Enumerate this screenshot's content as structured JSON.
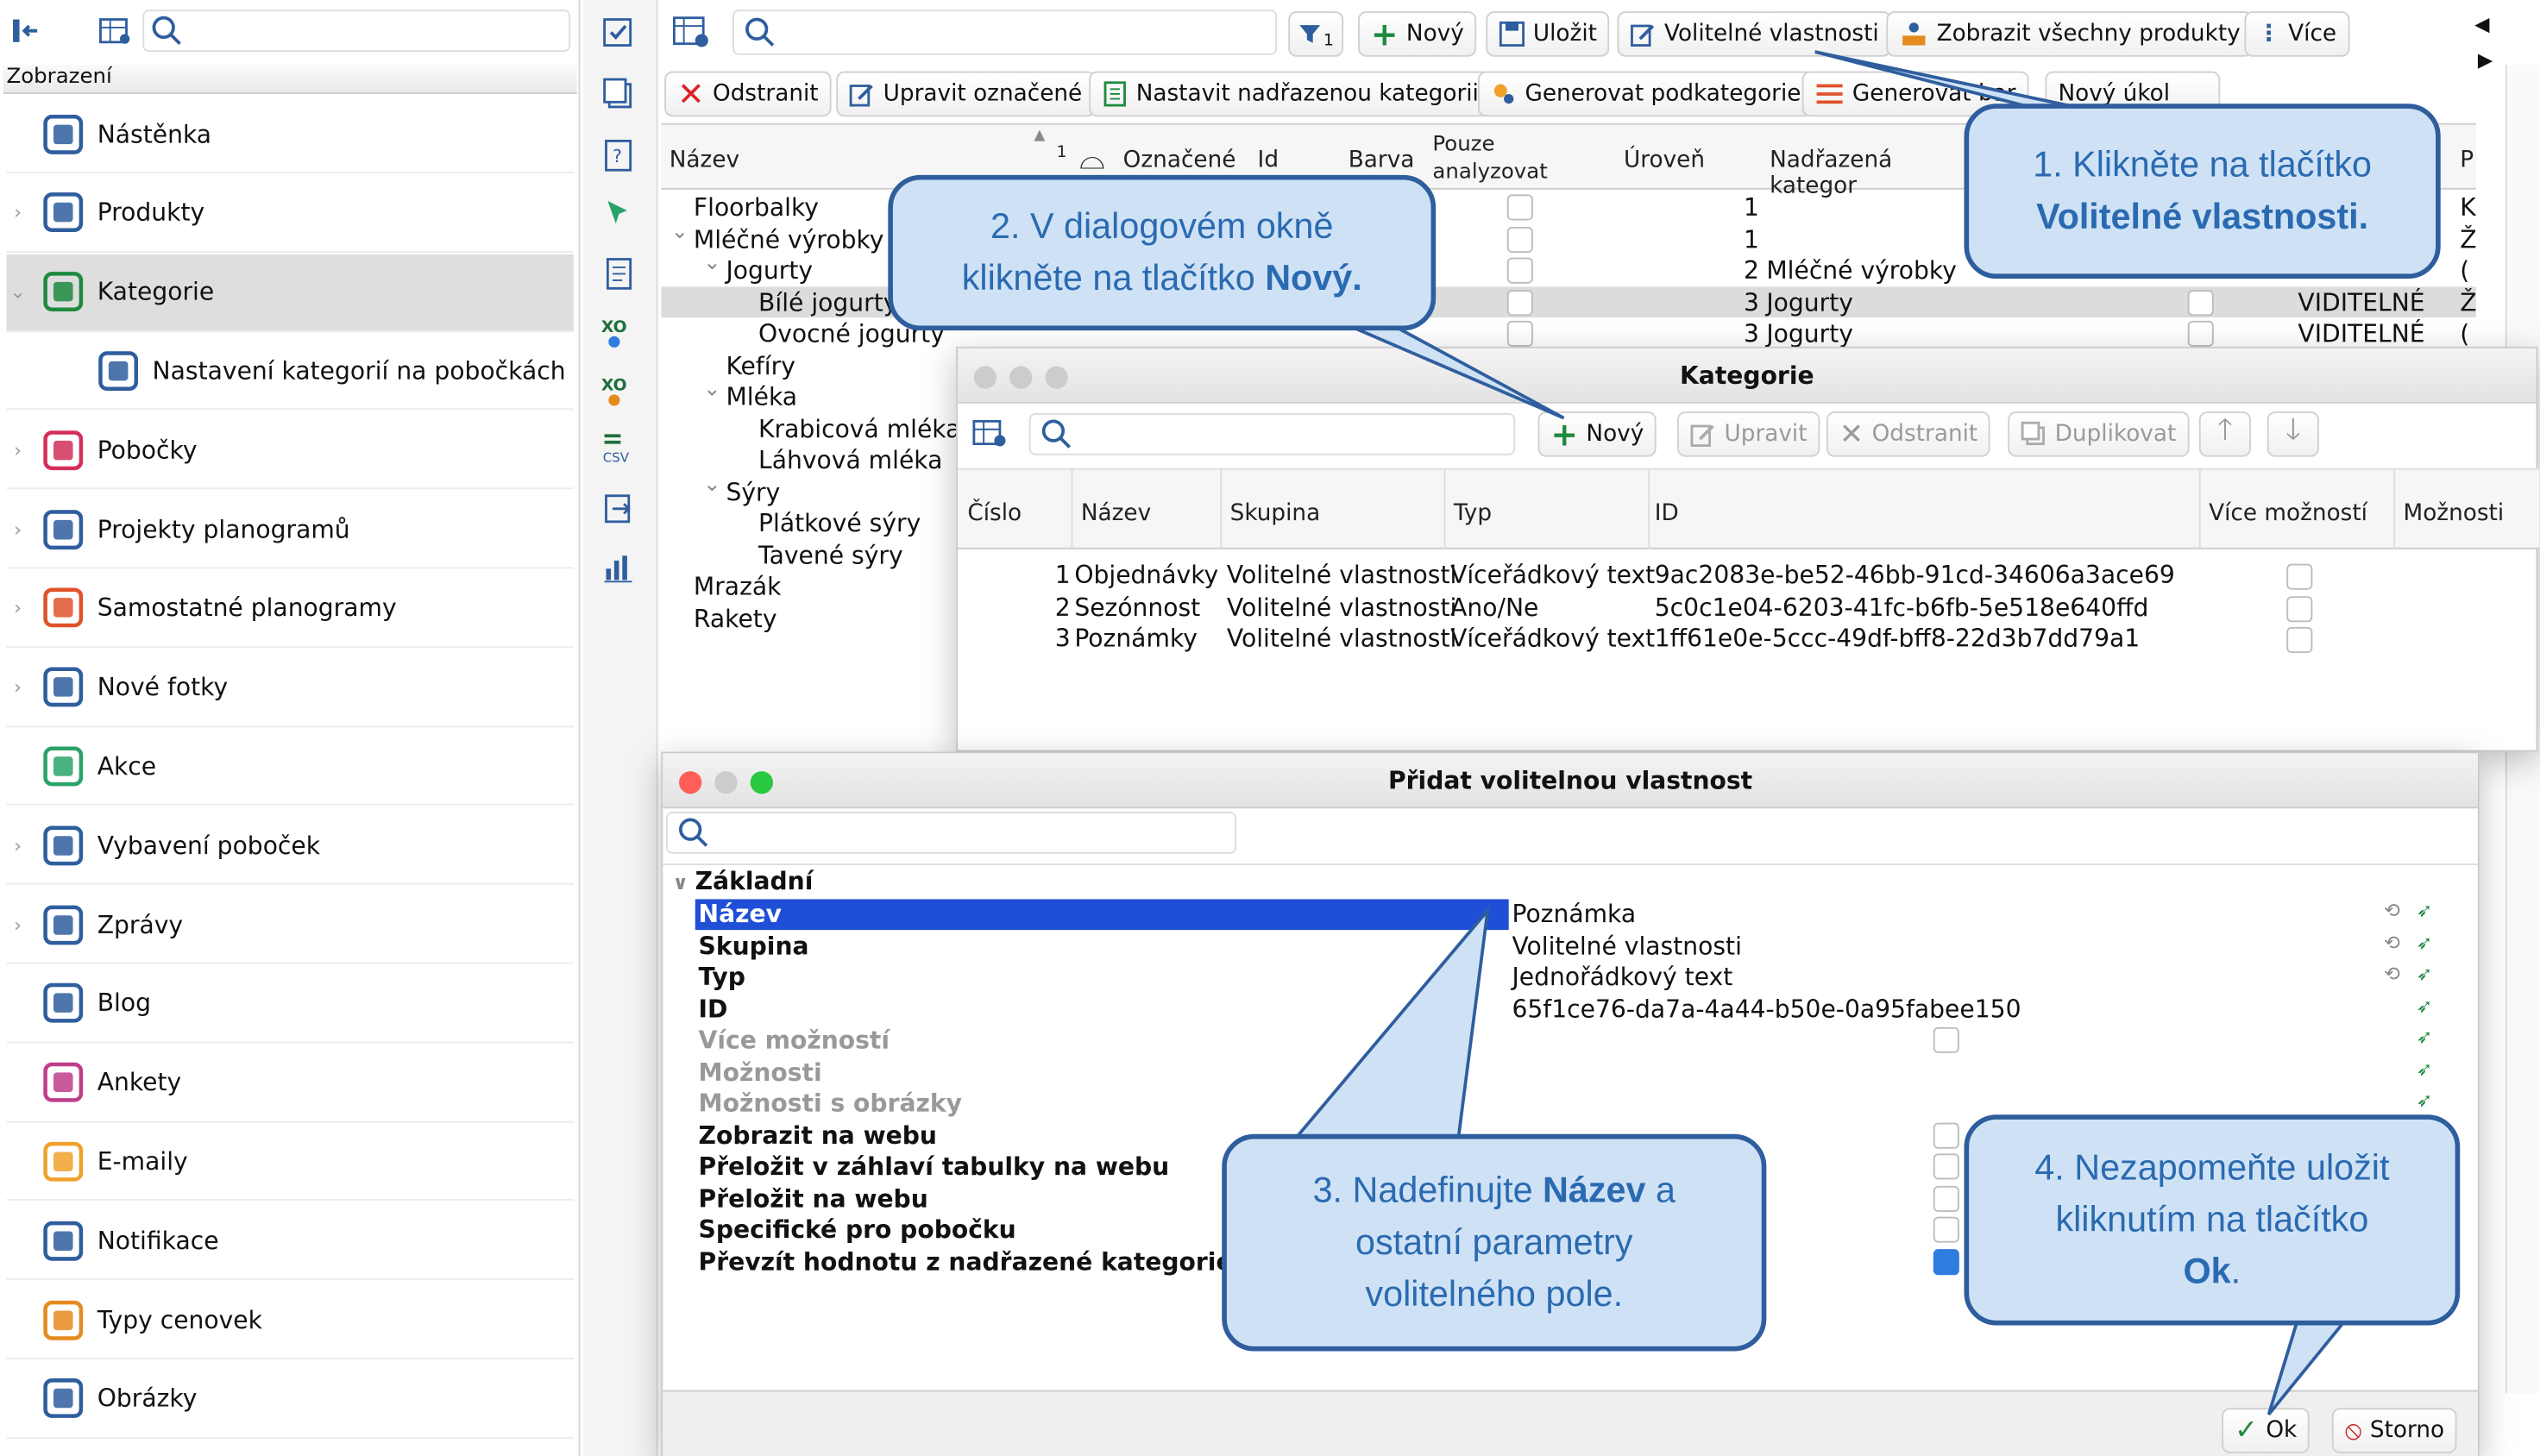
{
  "sidebar": {
    "section_title": "Zobrazení",
    "items": [
      {
        "label": "Nástěnka",
        "icon": "dashboard-icon"
      },
      {
        "label": "Produkty",
        "icon": "products-icon"
      },
      {
        "label": "Kategorie",
        "icon": "categories-icon"
      },
      {
        "label": "Nastavení kategorií na pobočkách",
        "icon": "category-settings-icon"
      },
      {
        "label": "Pobočky",
        "icon": "store-icon"
      },
      {
        "label": "Projekty planogramů",
        "icon": "planogram-projects-icon"
      },
      {
        "label": "Samostatné planogramy",
        "icon": "planograms-icon"
      },
      {
        "label": "Nové fotky",
        "icon": "camera-icon"
      },
      {
        "label": "Akce",
        "icon": "promotions-icon"
      },
      {
        "label": "Vybavení poboček",
        "icon": "equipment-icon"
      },
      {
        "label": "Zprávy",
        "icon": "messages-icon"
      },
      {
        "label": "Blog",
        "icon": "blog-icon"
      },
      {
        "label": "Ankety",
        "icon": "survey-icon"
      },
      {
        "label": "E-maily",
        "icon": "email-icon"
      },
      {
        "label": "Notifikace",
        "icon": "notification-icon"
      },
      {
        "label": "Typy cenovek",
        "icon": "price-tag-icon"
      },
      {
        "label": "Obrázky",
        "icon": "image-icon"
      }
    ]
  },
  "toolbar": {
    "filter_badge": "1",
    "new": "Nový",
    "save": "Uložit",
    "optional_props": "Volitelné vlastnosti",
    "show_all": "Zobrazit všechny produkty",
    "more": "Více",
    "delete": "Odstranit",
    "edit_marked": "Upravit označené",
    "set_parent": "Nastavit nadřazenou kategorii",
    "gen_sub": "Generovat podkategorie",
    "gen_colors": "Generovat bar",
    "new_task": "Nový úkol"
  },
  "grid": {
    "headers": {
      "name": "Název",
      "sort_idx": "1",
      "marked": "Označené",
      "id": "Id",
      "color": "Barva",
      "only_analyze": "Pouze analyzovat",
      "level": "Úroveň",
      "parent": "Nadřazená kategor",
      "right_col": "P"
    },
    "rows": [
      {
        "name": "Floorbalky",
        "level": "1",
        "parent": "",
        "vis": "",
        "last": "K"
      },
      {
        "name": "Mléčné výrobky",
        "level": "1",
        "parent": "",
        "vis": "",
        "last": "Ž"
      },
      {
        "name": "Jogurty",
        "level": "2",
        "parent": "Mléčné výrobky",
        "vis": "",
        "last": "("
      },
      {
        "name": "Bílé jogurty",
        "level": "3",
        "parent": "Jogurty",
        "vis": "VIDITELNÉ",
        "last": "Ž"
      },
      {
        "name": "Ovocné jogurty",
        "level": "3",
        "parent": "Jogurty",
        "vis": "VIDITELNÉ",
        "last": "("
      },
      {
        "name": "Kefíry"
      },
      {
        "name": "Mléka"
      },
      {
        "name": "Krabicová mléka"
      },
      {
        "name": "Láhvová mléka"
      },
      {
        "name": "Sýry"
      },
      {
        "name": "Plátkové sýry"
      },
      {
        "name": "Tavené sýry"
      },
      {
        "name": "Mrazák"
      },
      {
        "name": "Rakety"
      }
    ]
  },
  "kategorie_dialog": {
    "title": "Kategorie",
    "new": "Nový",
    "edit": "Upravit",
    "delete": "Odstranit",
    "duplicate": "Duplikovat",
    "headers": [
      "Číslo",
      "Název",
      "Skupina",
      "Typ",
      "ID",
      "Více možností",
      "Možnosti"
    ],
    "rows": [
      {
        "num": "1",
        "name": "Objednávky",
        "group": "Volitelné vlastnosti",
        "type": "Víceřádkový text",
        "id": "9ac2083e-be52-46bb-91cd-34606a3ace69"
      },
      {
        "num": "2",
        "name": "Sezónnost",
        "group": "Volitelné vlastnosti",
        "type": "Ano/Ne",
        "id": "5c0c1e04-6203-41fc-b6fb-5e518e640ffd"
      },
      {
        "num": "3",
        "name": "Poznámky",
        "group": "Volitelné vlastnosti",
        "type": "Víceřádkový text",
        "id": "1ff61e0e-5ccc-49df-bff8-22d3b7dd79a1"
      }
    ]
  },
  "add_dialog": {
    "title": "Přidat volitelnou vlastnost",
    "section": "Základní",
    "props": [
      {
        "name": "Název",
        "value": "Poznámka"
      },
      {
        "name": "Skupina",
        "value": "Volitelné vlastnosti"
      },
      {
        "name": "Typ",
        "value": "Jednořádkový text"
      },
      {
        "name": "ID",
        "value": "65f1ce76-da7a-4a44-b50e-0a95fabee150"
      },
      {
        "name": "Více možností",
        "value": ""
      },
      {
        "name": "Možnosti",
        "value": ""
      },
      {
        "name": "Možnosti s obrázky",
        "value": ""
      },
      {
        "name": "Zobrazit na webu",
        "value": ""
      },
      {
        "name": "Přeložit v záhlaví tabulky na webu",
        "value": ""
      },
      {
        "name": "Přeložit na webu",
        "value": ""
      },
      {
        "name": "Specifické pro pobočku",
        "value": ""
      },
      {
        "name": "Převzít hodnotu z nadřazené kategorie",
        "value": ""
      }
    ],
    "ok": "Ok",
    "cancel": "Storno"
  },
  "callouts": {
    "c1_line1": "1. Klikněte na tlačítko",
    "c1_line2": "Volitelné vlastnosti.",
    "c2_line1": "2. V dialogovém okně",
    "c2_line2a": "klikněte na tlačítko ",
    "c2_line2b": "Nový.",
    "c3_line1a": "3. Nadefinujte ",
    "c3_line1b": "Název",
    "c3_line1c": " a",
    "c3_line2": "ostatní parametry",
    "c3_line3": "volitelného pole.",
    "c4_line1": "4. Nezapomeňte uložit",
    "c4_line2": "kliknutím na tlačítko",
    "c4_line3a": "Ok",
    "c4_line3b": "."
  },
  "colors": {
    "accent": "#2f5e9e",
    "callout_bg": "#cfe2f5",
    "selection": "#1f4fd6"
  }
}
